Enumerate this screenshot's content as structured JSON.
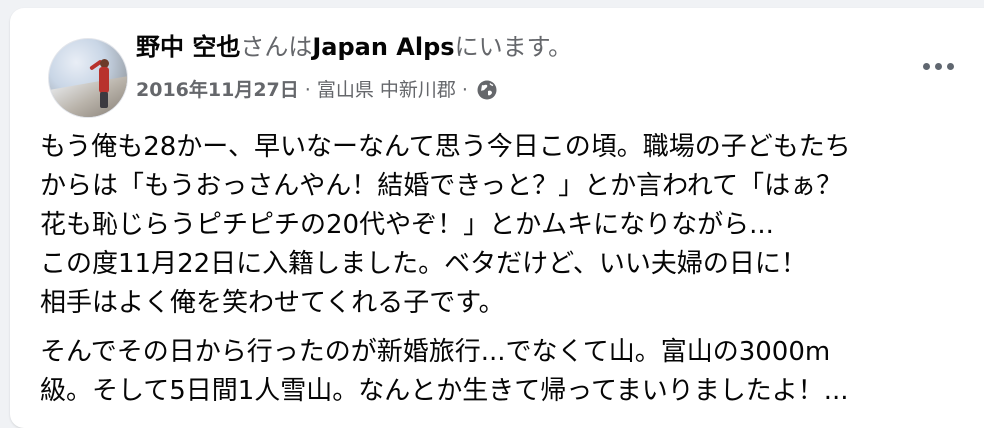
{
  "post": {
    "author_name": "野中 空也",
    "location_prefix": "さんは",
    "location_name": "Japan Alps",
    "location_suffix": "にいます。",
    "date": "2016年11月27日",
    "separator": "·",
    "place": "富山県 中新川郡",
    "privacy_icon": "globe-icon",
    "more_icon": "more-dots-icon",
    "body": {
      "paragraph1": [
        "もう俺も28かー、早いなーなんて思う今日この頃。職場の子どもたち",
        "からは「もうおっさんやん！結婚できっと？」とか言われて「はぁ？",
        "花も恥じらうピチピチの20代やぞ！」とかムキになりながら...",
        "この度11月22日に入籍しました。ベタだけど、いい夫婦の日に！",
        "相手はよく俺を笑わせてくれる子です。"
      ],
      "paragraph2": [
        "そんでその日から行ったのが新婚旅行...でなくて山。富山の3000m",
        "級。そして5日間1人雪山。なんとか生きて帰ってまいりましたよ！..."
      ]
    }
  },
  "colors": {
    "background": "#f0f2f5",
    "card": "#ffffff",
    "primary_text": "#050505",
    "secondary_text": "#65676b"
  }
}
